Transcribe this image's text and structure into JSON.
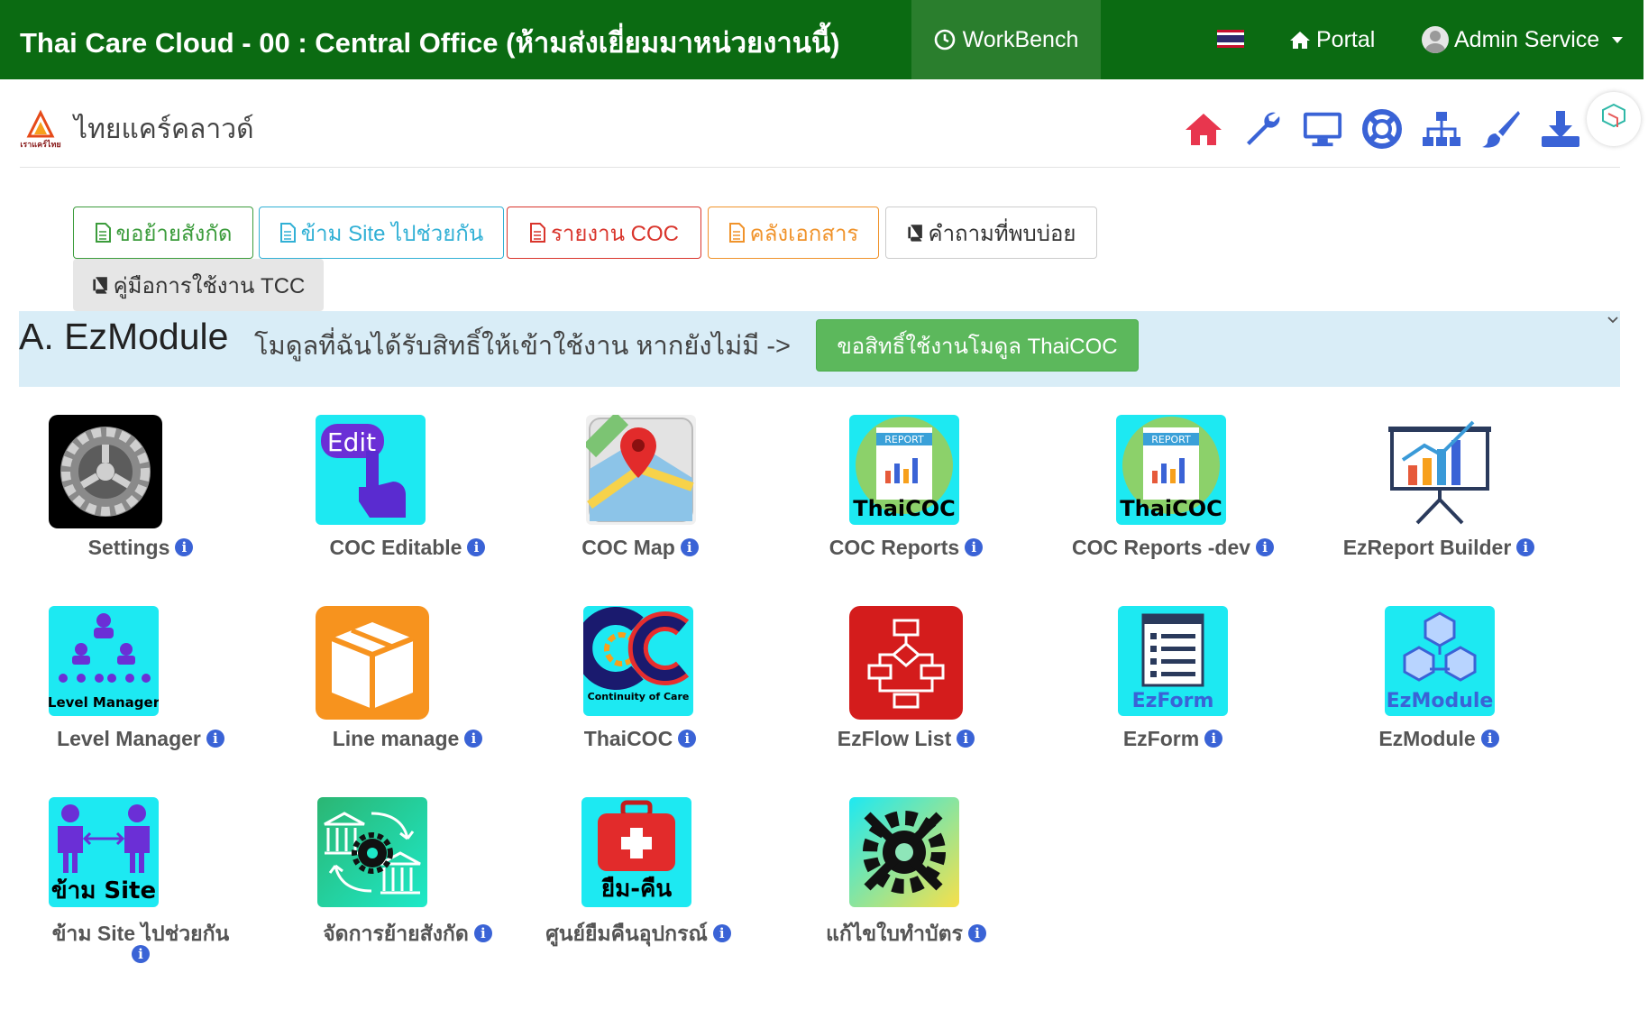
{
  "navbar": {
    "title": "Thai Care Cloud - 00 : Central Office (ห้ามส่งเยี่ยมมาหน่วยงานนี้)",
    "workbench": "WorkBench",
    "portal": "Portal",
    "user": "Admin Service",
    "bg_color": "#0b6b12"
  },
  "subheader": {
    "title": "ไทยแคร์คลาวด์",
    "logo_text": "เราแคร์ไทย"
  },
  "toolbar_icons": [
    "home-icon",
    "wrench-icon",
    "monitor-icon",
    "life-ring-icon",
    "sitemap-icon",
    "paint-brush-icon",
    "download-icon",
    "cogs-icon"
  ],
  "buttons": [
    {
      "label": "ขอย้ายสังกัด",
      "color": "#3c9c3c"
    },
    {
      "label": "ข้าม Site ไปช่วยกัน",
      "color": "#31b0d5"
    },
    {
      "label": "รายงาน COC",
      "color": "#d9352c"
    },
    {
      "label": "คลังเอกสาร",
      "color": "#f0932b"
    },
    {
      "label": "คำถามที่พบบ่อย",
      "color": "#333333"
    },
    {
      "label": "คู่มือการใช้งาน TCC",
      "color": "#333333"
    }
  ],
  "module": {
    "title": "A. EzModule",
    "desc": "โมดูลที่ฉันได้รับสิทธิ์ให้เข้าใช้งาน หากยังไม่มี ->",
    "request_btn": "ขอสิทธิ์ใช้งานโมดูล ThaiCOC"
  },
  "tiles": [
    {
      "label": "Settings",
      "icon": "settings-gear-icon"
    },
    {
      "label": "COC Editable",
      "icon": "edit-hand-icon",
      "img_text": "Edit"
    },
    {
      "label": "COC Map",
      "icon": "map-pin-icon"
    },
    {
      "label": "COC Reports",
      "icon": "report-chart-icon",
      "img_text": "ThaiCOC",
      "img_sub": "REPORT"
    },
    {
      "label": "COC Reports -dev",
      "icon": "report-chart-icon",
      "img_text": "ThaiCOC",
      "img_sub": "REPORT"
    },
    {
      "label": "EzReport Builder",
      "icon": "presentation-chart-icon"
    },
    {
      "label": "Level Manager",
      "icon": "org-chart-icon",
      "img_text": "Level Manager"
    },
    {
      "label": "Line manage",
      "icon": "box-icon"
    },
    {
      "label": "ThaiCOC",
      "icon": "coc-logo-icon",
      "img_text": "Continuity of Care"
    },
    {
      "label": "EzFlow List",
      "icon": "flowchart-icon"
    },
    {
      "label": "EzForm",
      "icon": "form-icon",
      "img_text": "EzForm"
    },
    {
      "label": "EzModule",
      "icon": "cubes-icon",
      "img_text": "EzModule"
    },
    {
      "label": "ข้าม Site ไปช่วยกัน",
      "icon": "people-exchange-icon",
      "img_text": "ข้าม Site"
    },
    {
      "label": "จัดการย้ายสังกัด",
      "icon": "bank-transfer-icon"
    },
    {
      "label": "ศูนย์ยืมคืนอุปกรณ์",
      "icon": "medkit-icon",
      "img_text": "ยืม-คืน"
    },
    {
      "label": "แก้ไขใบทำบัตร",
      "icon": "gear-tools-icon"
    }
  ],
  "info_glyph": "i"
}
